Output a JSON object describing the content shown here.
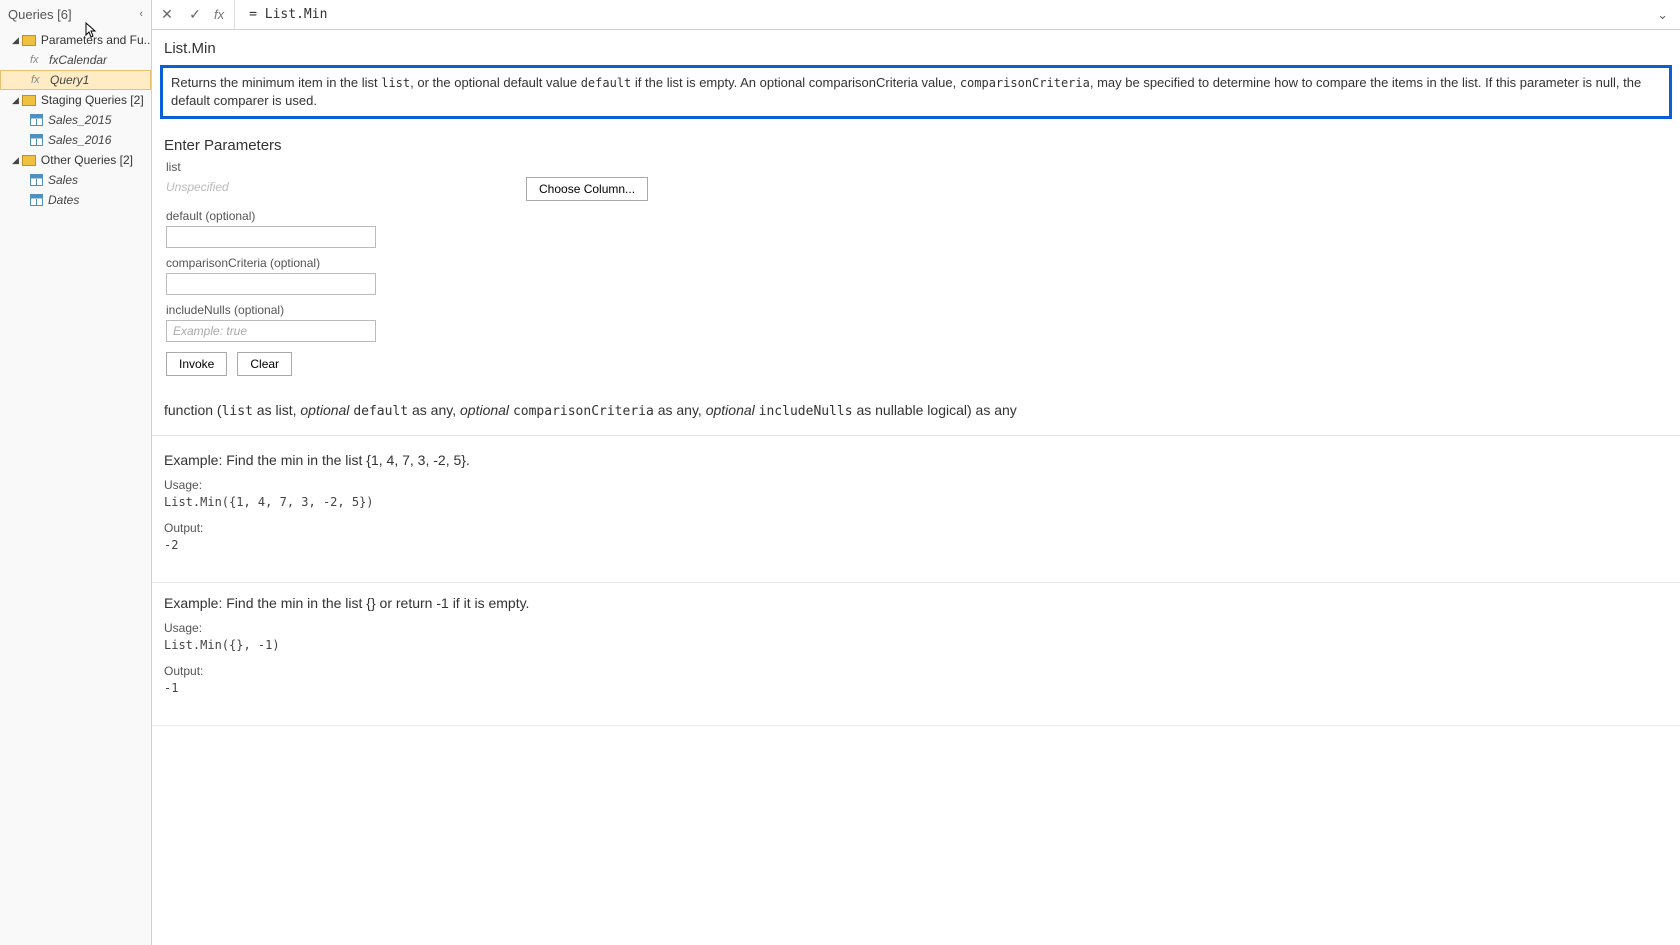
{
  "sidebar": {
    "title": "Queries [6]",
    "groups": [
      {
        "label": "Parameters and Fu...",
        "items": [
          {
            "label": "fxCalendar",
            "iconType": "fx"
          },
          {
            "label": "Query1",
            "iconType": "fx",
            "selected": true
          }
        ]
      },
      {
        "label": "Staging Queries [2]",
        "items": [
          {
            "label": "Sales_2015",
            "iconType": "table"
          },
          {
            "label": "Sales_2016",
            "iconType": "table"
          }
        ]
      },
      {
        "label": "Other Queries [2]",
        "items": [
          {
            "label": "Sales",
            "iconType": "table"
          },
          {
            "label": "Dates",
            "iconType": "table"
          }
        ]
      }
    ]
  },
  "formulaBar": {
    "value": "= List.Min"
  },
  "functionDoc": {
    "name": "List.Min",
    "description": {
      "pre1": "Returns the minimum item in the list ",
      "code1": "list",
      "mid1": ", or the optional default value ",
      "code2": "default",
      "mid2": " if the list is empty. An optional comparisonCriteria value, ",
      "code3": "comparisonCriteria",
      "post": ", may be specified to determine how to compare the items in the list. If this parameter is null, the default comparer is used."
    },
    "enterParamsTitle": "Enter Parameters",
    "params": {
      "listLabel": "list",
      "listPlaceholder": "Unspecified",
      "chooseColumn": "Choose Column...",
      "defaultLabel": "default (optional)",
      "comparisonLabel": "comparisonCriteria (optional)",
      "includeNullsLabel": "includeNulls (optional)",
      "includeNullsPlaceholder": "Example: true",
      "invokeLabel": "Invoke",
      "clearLabel": "Clear"
    },
    "signature": {
      "prefix": "function (",
      "p1code": "list",
      "p1rest": " as list, ",
      "opt": "optional",
      "p2code": "default",
      "p2rest": " as any, ",
      "p3code": "comparisonCriteria",
      "p3rest": " as any, ",
      "p4code": "includeNulls",
      "p4rest": " as nullable logical) as any"
    },
    "examples": [
      {
        "title": "Example: Find the min in the list {1, 4, 7, 3, -2, 5}.",
        "usageLabel": "Usage:",
        "usageCode": "List.Min({1, 4, 7, 3, -2, 5})",
        "outputLabel": "Output:",
        "outputCode": "-2"
      },
      {
        "title": "Example: Find the min in the list {} or return -1 if it is empty.",
        "usageLabel": "Usage:",
        "usageCode": "List.Min({}, -1)",
        "outputLabel": "Output:",
        "outputCode": "-1"
      }
    ]
  }
}
